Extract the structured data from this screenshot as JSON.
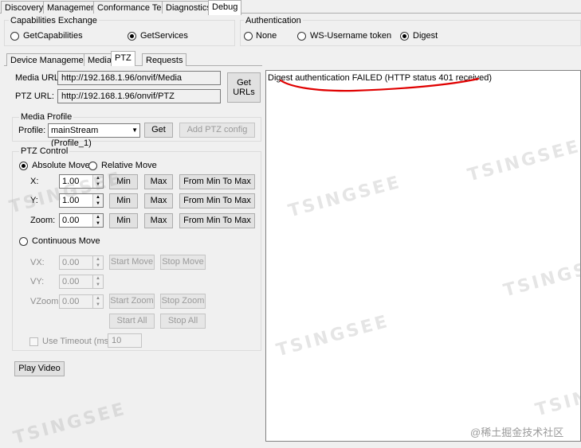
{
  "top_tabs": [
    "Discovery",
    "Management",
    "Conformance Test",
    "Diagnostics",
    "Debug"
  ],
  "capabilities": {
    "title": "Capabilities Exchange",
    "options": [
      "GetCapabilities",
      "GetServices"
    ],
    "selected": "GetServices"
  },
  "authentication": {
    "title": "Authentication",
    "options": [
      "None",
      "WS-Username token",
      "Digest"
    ],
    "selected": "Digest"
  },
  "sub_tabs": [
    "Device Management",
    "Media",
    "PTZ",
    "Requests"
  ],
  "urls": {
    "media_label": "Media URL:",
    "media_value": "http://192.168.1.96/onvif/Media",
    "ptz_label": "PTZ URL:",
    "ptz_value": "http://192.168.1.96/onvif/PTZ",
    "get_urls_label": "Get URLs"
  },
  "media_profile": {
    "title": "Media Profile",
    "profile_label": "Profile:",
    "profile_value": "mainStream (Profile_1)",
    "get_label": "Get",
    "add_ptz_label": "Add PTZ config"
  },
  "ptz_control": {
    "title": "PTZ Control",
    "absolute_move": "Absolute Move",
    "relative_move": "Relative Move",
    "x_label": "X:",
    "x_value": "1.00",
    "y_label": "Y:",
    "y_value": "1.00",
    "zoom_label": "Zoom:",
    "zoom_value": "0.00",
    "min_label": "Min",
    "max_label": "Max",
    "from_min_to_max": "From Min To Max",
    "continuous_move": "Continuous Move",
    "vx_label": "VX:",
    "vx_value": "0.00",
    "vy_label": "VY:",
    "vy_value": "0.00",
    "vzoom_label": "VZoom:",
    "vzoom_value": "0.00",
    "start_move": "Start Move",
    "stop_move": "Stop Move",
    "start_zoom": "Start Zoom",
    "stop_zoom": "Stop Zoom",
    "start_all": "Start All",
    "stop_all": "Stop All",
    "use_timeout": "Use Timeout (ms)",
    "timeout_value": "10"
  },
  "play_video": "Play Video",
  "output_text": "Digest authentication FAILED (HTTP status 401 received)",
  "watermark": "TSINGSEE",
  "corner_watermark": "@稀土掘金技术社区",
  "colors": {
    "annotation": "#e00000"
  }
}
